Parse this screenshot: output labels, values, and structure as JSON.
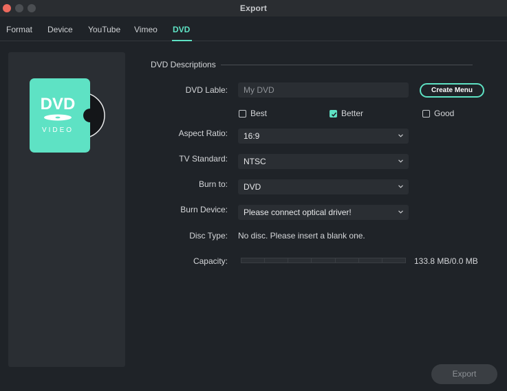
{
  "window": {
    "title": "Export"
  },
  "tabs": [
    {
      "label": "Format"
    },
    {
      "label": "Device"
    },
    {
      "label": "YouTube"
    },
    {
      "label": "Vimeo"
    },
    {
      "label": "DVD",
      "active": true
    }
  ],
  "preview": {
    "art_title": "DVD",
    "art_subtitle": "VIDEO",
    "accent_color": "#5ee2c4"
  },
  "form": {
    "section_title": "DVD Descriptions",
    "dvd_label": {
      "label": "DVD Lable:",
      "placeholder": "My DVD"
    },
    "create_menu_label": "Create Menu",
    "quality": [
      {
        "label": "Best",
        "checked": false
      },
      {
        "label": "Better",
        "checked": true
      },
      {
        "label": "Good",
        "checked": false
      }
    ],
    "aspect_ratio": {
      "label": "Aspect Ratio:",
      "value": "16:9"
    },
    "tv_standard": {
      "label": "TV Standard:",
      "value": "NTSC"
    },
    "burn_to": {
      "label": "Burn to:",
      "value": "DVD"
    },
    "burn_device": {
      "label": "Burn Device:",
      "value": "Please connect optical driver!"
    },
    "disc_type": {
      "label": "Disc Type:",
      "value": "No disc. Please insert a blank one."
    },
    "capacity": {
      "label": "Capacity:",
      "value": "133.8 MB/0.0 MB",
      "fraction": 0
    }
  },
  "footer": {
    "export_label": "Export"
  }
}
